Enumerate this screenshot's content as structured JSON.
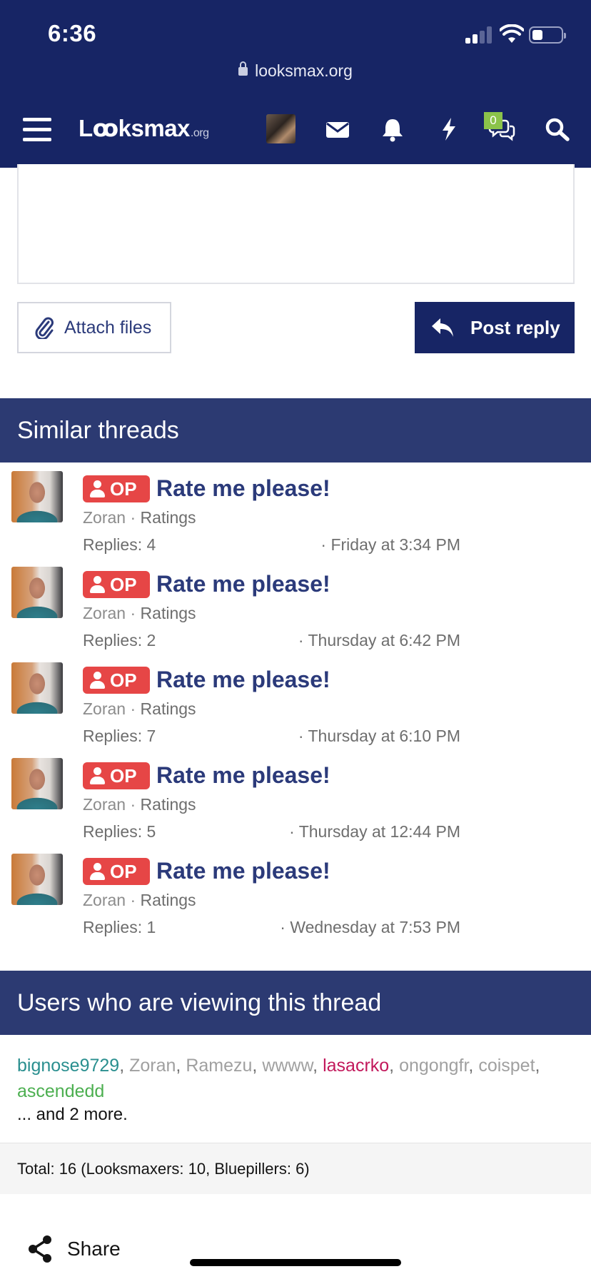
{
  "status_bar": {
    "time": "6:36"
  },
  "browser": {
    "url": "looksmax.org"
  },
  "nav": {
    "logo": "Lꝏksmax",
    "logo_suffix": ".org",
    "conversations_badge": "0"
  },
  "reply": {
    "attach_label": "Attach files",
    "post_label": "Post reply"
  },
  "similar": {
    "title": "Similar threads",
    "threads": [
      {
        "prefix": "OP",
        "title": "Rate me please!",
        "author": "Zoran",
        "separator": " · ",
        "forum": "Ratings",
        "replies": "Replies: 4",
        "date": "· Friday at 3:34 PM"
      },
      {
        "prefix": "OP",
        "title": "Rate me please!",
        "author": "Zoran",
        "separator": " · ",
        "forum": "Ratings",
        "replies": "Replies: 2",
        "date": "· Thursday at 6:42 PM"
      },
      {
        "prefix": "OP",
        "title": "Rate me please!",
        "author": "Zoran",
        "separator": " · ",
        "forum": "Ratings",
        "replies": "Replies: 7",
        "date": "· Thursday at 6:10 PM"
      },
      {
        "prefix": "OP",
        "title": "Rate me please!",
        "author": "Zoran",
        "separator": " · ",
        "forum": "Ratings",
        "replies": "Replies: 5",
        "date": "· Thursday at 12:44 PM"
      },
      {
        "prefix": "OP",
        "title": "Rate me please!",
        "author": "Zoran",
        "separator": " · ",
        "forum": "Ratings",
        "replies": "Replies: 1",
        "date": "· Wednesday at 7:53 PM"
      }
    ]
  },
  "viewers": {
    "title": "Users who are viewing this thread",
    "users": [
      {
        "name": "bignose9729",
        "color": "#2a8f8f"
      },
      {
        "name": "Zoran",
        "color": "#a0a0a0"
      },
      {
        "name": "Ramezu",
        "color": "#a0a0a0"
      },
      {
        "name": "wwww",
        "color": "#a0a0a0"
      },
      {
        "name": "lasacrko",
        "color": "#c2185b"
      },
      {
        "name": "ongongfr",
        "color": "#a0a0a0"
      },
      {
        "name": "coispet",
        "color": "#a0a0a0"
      },
      {
        "name": "ascendedd",
        "color": "#4caf50"
      }
    ],
    "more": "... and 2 more.",
    "total": "Total: 16 (Looksmaxers: 10, Bluepillers: 6)"
  },
  "share": {
    "label": "Share"
  },
  "colors": {
    "header": "#172565",
    "block_head": "#2c3a72",
    "title_link": "#2b3a7a",
    "op_badge": "#e64646"
  },
  "icons": [
    "menu-icon",
    "envelope-icon",
    "bell-icon",
    "lightning-icon",
    "chat-icon",
    "search-icon",
    "paperclip-icon",
    "reply-arrow-icon",
    "share-icon",
    "lock-icon"
  ]
}
